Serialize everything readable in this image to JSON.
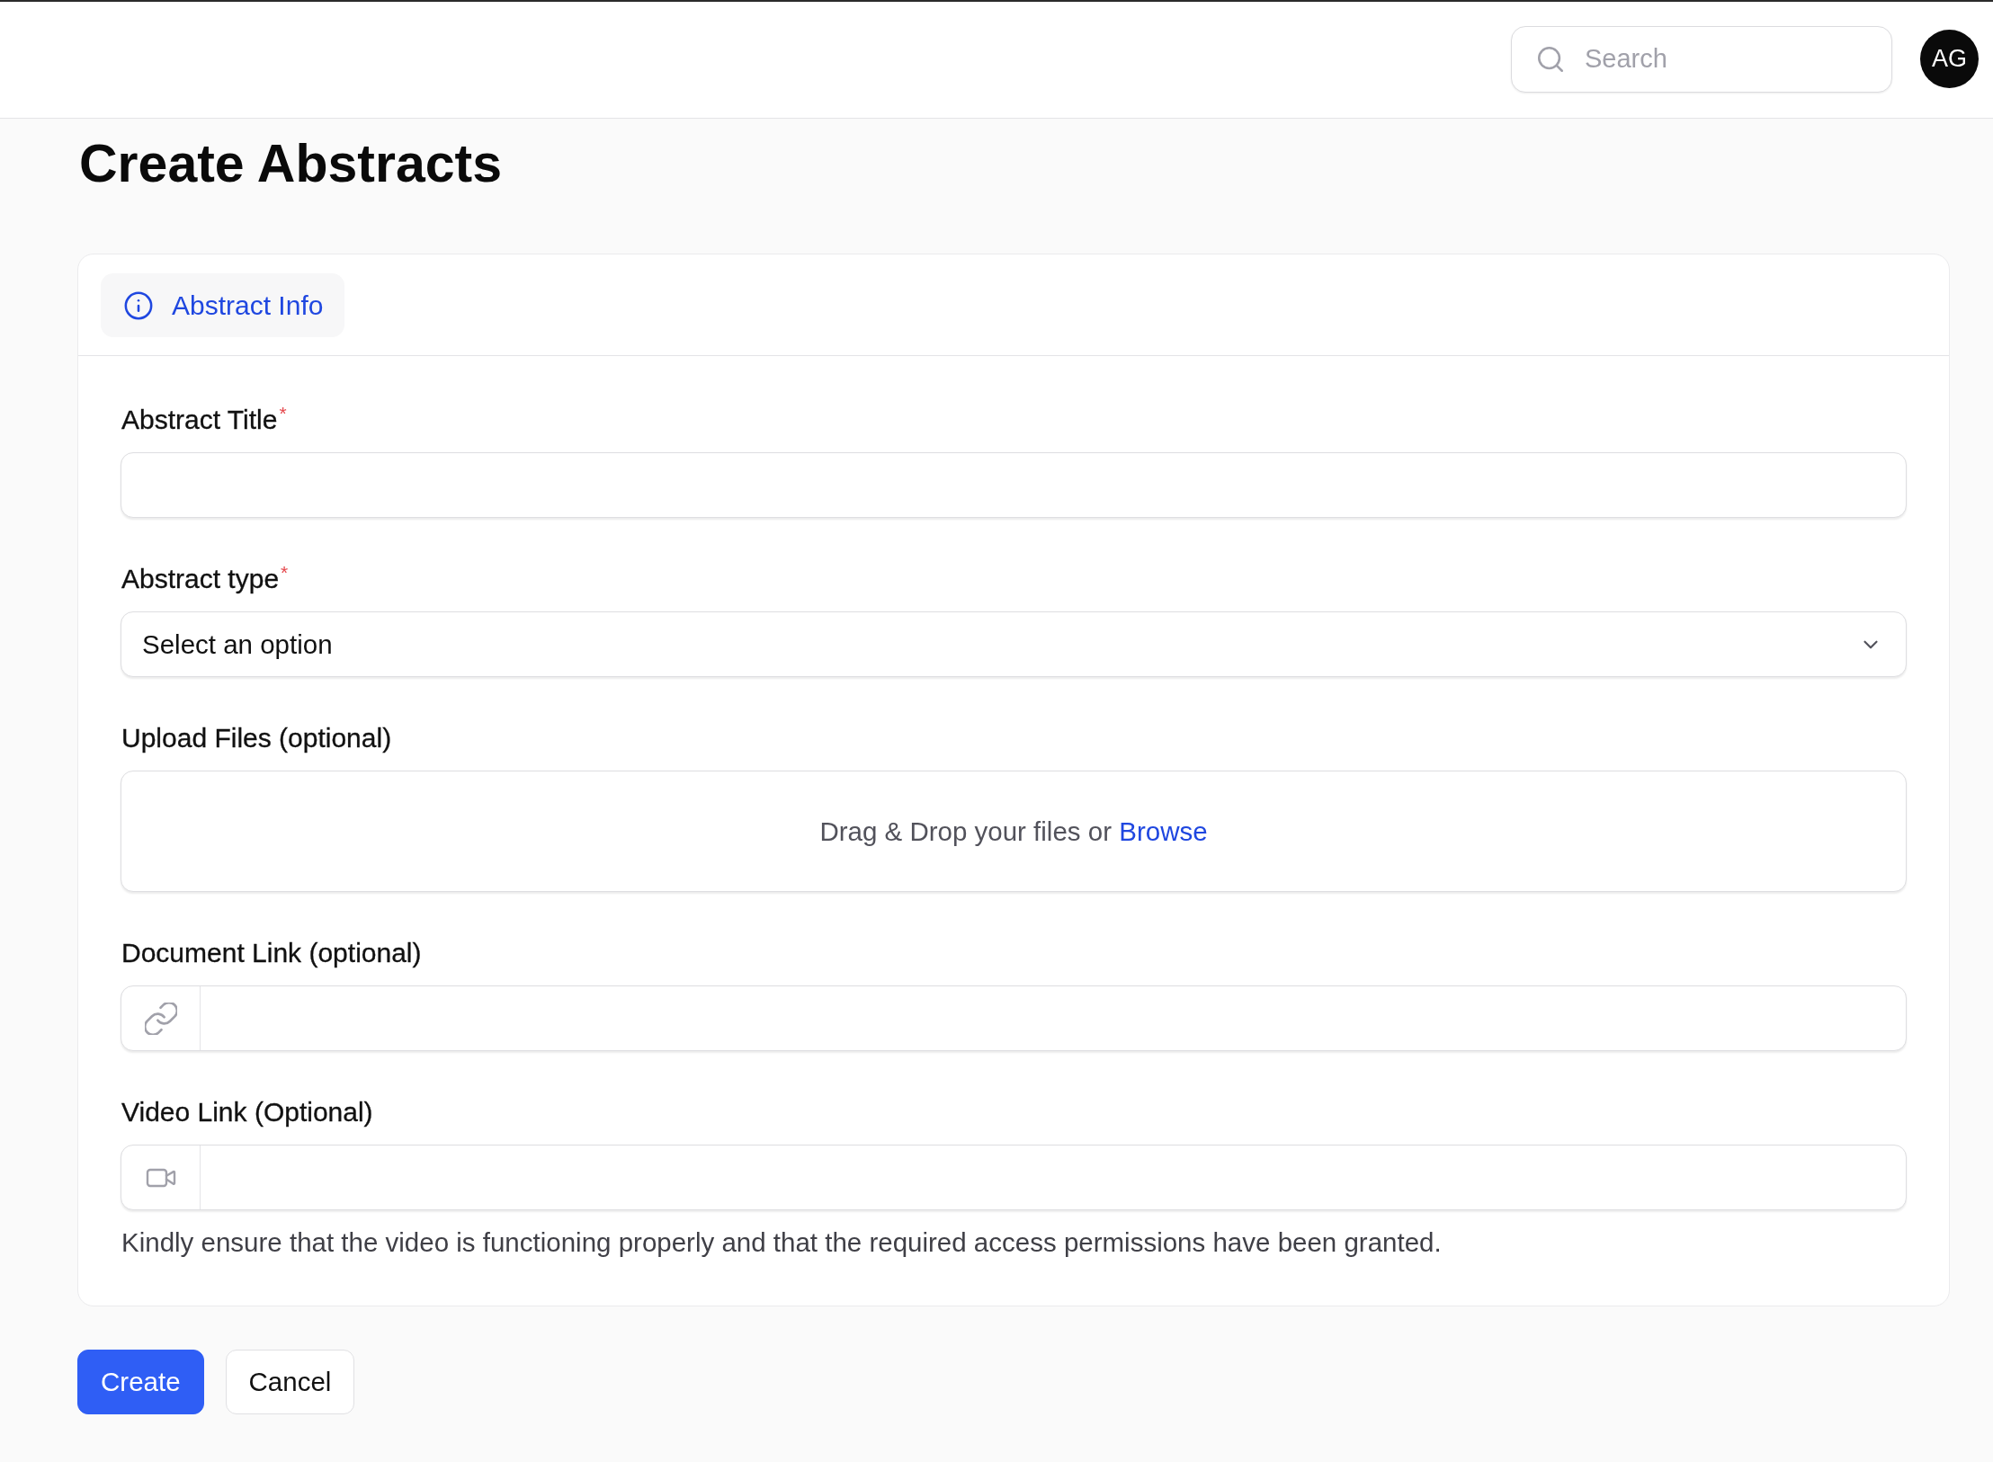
{
  "header": {
    "search": {
      "placeholder": "Search"
    },
    "avatar": {
      "initials": "AG"
    }
  },
  "page_title": "Create Abstracts",
  "tabs": [
    {
      "label": "Abstract Info",
      "selected": true
    }
  ],
  "fields": [
    {
      "kind": "text",
      "label": "Abstract Title",
      "required_mark": "*"
    },
    {
      "kind": "select",
      "label": "Abstract type",
      "required_mark": "*",
      "placeholder": "Select an option"
    },
    {
      "kind": "upload",
      "label": "Upload Files (optional)",
      "prompt": "Drag & Drop your files or",
      "link": "Browse"
    },
    {
      "kind": "link",
      "label": "Document Link (optional)"
    },
    {
      "kind": "video",
      "label": "Video Link (Optional)",
      "hint": "Kindly ensure that the video is functioning properly and that the required access permissions have been granted."
    }
  ],
  "buttons": [
    {
      "label": "Create",
      "kind": "primary"
    },
    {
      "label": "Cancel",
      "kind": "secondary"
    }
  ]
}
